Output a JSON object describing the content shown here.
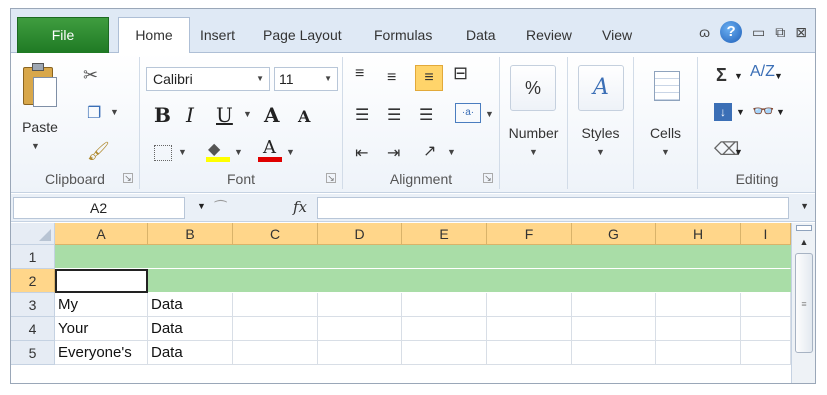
{
  "tabs": {
    "file": "File",
    "home": "Home",
    "insert": "Insert",
    "page_layout": "Page Layout",
    "formulas": "Formulas",
    "data": "Data",
    "review": "Review",
    "view": "View"
  },
  "window_controls": {
    "minimize_ribbon": "ɷ",
    "help": "?",
    "minimize": "▭",
    "restore": "⧉",
    "close": "⊠"
  },
  "ribbon": {
    "clipboard": {
      "label": "Clipboard",
      "paste": "Paste"
    },
    "font": {
      "label": "Font",
      "font_name": "Calibri",
      "font_size": "11",
      "bold": "B",
      "italic": "I",
      "underline": "U",
      "grow": "A",
      "shrink": "A",
      "font_color_letter": "A",
      "fill_color": "#ffff00",
      "font_color": "#e00000"
    },
    "alignment": {
      "label": "Alignment",
      "merge": "·a·"
    },
    "number": {
      "label": "Number",
      "icon": "%"
    },
    "styles": {
      "label": "Styles",
      "icon": "A"
    },
    "cells": {
      "label": "Cells"
    },
    "editing": {
      "label": "Editing",
      "autosum": "Σ",
      "sort": "A/Z",
      "find": "👓"
    }
  },
  "formula_bar": {
    "name_box": "A2",
    "fx": "fx",
    "formula": ""
  },
  "grid": {
    "columns": [
      "A",
      "B",
      "C",
      "D",
      "E",
      "F",
      "G",
      "H",
      "I"
    ],
    "rows": [
      {
        "num": "1",
        "cells": [
          "",
          ""
        ]
      },
      {
        "num": "2",
        "cells": [
          "",
          ""
        ]
      },
      {
        "num": "3",
        "cells": [
          "My",
          "Data"
        ]
      },
      {
        "num": "4",
        "cells": [
          "Your",
          "Data"
        ]
      },
      {
        "num": "5",
        "cells": [
          "Everyone's",
          "Data"
        ]
      }
    ],
    "highlight_color": "#a9dda7",
    "active_cell": "A2"
  }
}
